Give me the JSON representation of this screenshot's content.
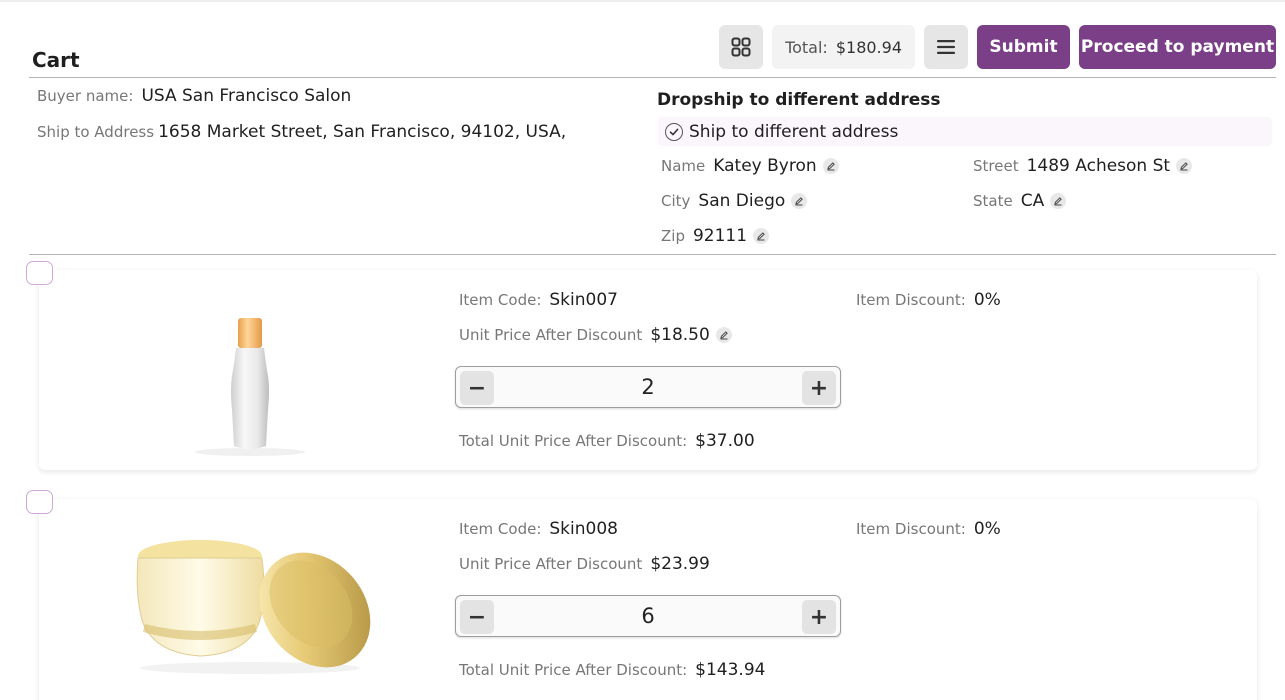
{
  "cart": {
    "title": "Cart"
  },
  "toolbar": {
    "grid_icon": "grid-icon",
    "total_label": "Total:",
    "total_value": "$180.94",
    "menu_icon": "menu-icon",
    "submit_label": "Submit",
    "proceed_label": "Proceed to payment",
    "accent_color": "#7b3f88"
  },
  "buyer": {
    "name_label": "Buyer name:",
    "name_value": "USA San Francisco Salon",
    "ship_label": "Ship to Address",
    "ship_value": "1658 Market Street, San Francisco, 94102, USA,"
  },
  "dropship": {
    "title": "Dropship to different address",
    "checkbox_label": "Ship to different address",
    "checked": true,
    "name_label": "Name",
    "name_value": "Katey Byron",
    "street_label": "Street",
    "street_value": "1489 Acheson St",
    "city_label": "City",
    "city_value": "San Diego",
    "state_label": "State",
    "state_value": "CA",
    "zip_label": "Zip",
    "zip_value": "92111"
  },
  "items": [
    {
      "code_label": "Item Code:",
      "code": "Skin007",
      "discount_label": "Item Discount:",
      "discount": "0%",
      "unit_price_label": "Unit Price After Discount",
      "unit_price": "$18.50",
      "quantity": "2",
      "total_label": "Total Unit Price After Discount:",
      "total": "$37.00",
      "image": "serum-bottle-image"
    },
    {
      "code_label": "Item Code:",
      "code": "Skin008",
      "discount_label": "Item Discount:",
      "discount": "0%",
      "unit_price_label": "Unit Price After Discount",
      "unit_price": "$23.99",
      "quantity": "6",
      "total_label": "Total Unit Price After Discount:",
      "total": "$143.94",
      "image": "cream-jar-image"
    }
  ]
}
